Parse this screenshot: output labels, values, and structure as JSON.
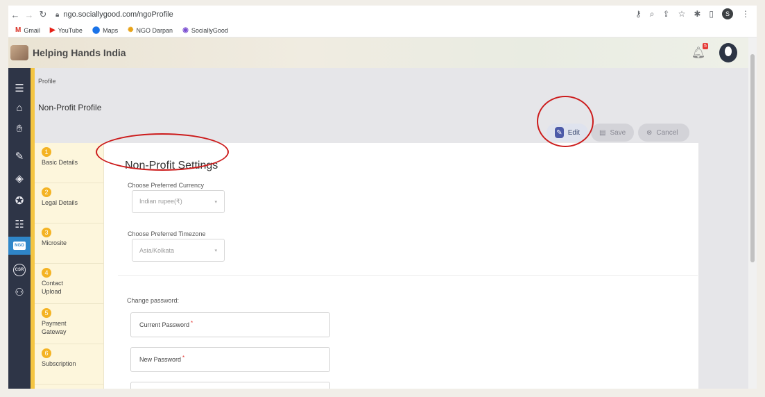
{
  "browser": {
    "url": "ngo.sociallygood.com/ngoProfile",
    "profile_initial": "S",
    "bookmarks": [
      {
        "label": "Gmail",
        "icon": "gmail-icon"
      },
      {
        "label": "YouTube",
        "icon": "youtube-icon"
      },
      {
        "label": "Maps",
        "icon": "maps-icon"
      },
      {
        "label": "NGO Darpan",
        "icon": "ngo-darpan-icon"
      },
      {
        "label": "SociallyGood",
        "icon": "sociallygood-icon"
      }
    ]
  },
  "header": {
    "org_name": "Helping Hands India",
    "notification_count": "5"
  },
  "leftnav": {
    "items": [
      "menu-icon",
      "home-icon",
      "handshake-icon",
      "donation-icon",
      "badge-icon",
      "award-icon",
      "contacts-icon",
      "ngo-icon",
      "csr-icon",
      "users-icon"
    ],
    "active": "ngo-icon",
    "ngo_label": "NGO",
    "csr_label": "CSR"
  },
  "page": {
    "breadcrumb": "Profile",
    "title": "Non-Profit Profile"
  },
  "actions": {
    "edit": "Edit",
    "save": "Save",
    "cancel": "Cancel"
  },
  "steps": [
    {
      "num": "1",
      "label": "Basic Details"
    },
    {
      "num": "2",
      "label": "Legal Details"
    },
    {
      "num": "3",
      "label": "Microsite"
    },
    {
      "num": "4",
      "label": "Contact Upload"
    },
    {
      "num": "5",
      "label": "Payment Gateway"
    },
    {
      "num": "6",
      "label": "Subscription"
    }
  ],
  "settings": {
    "title": "Non-Profit Settings",
    "currency_label": "Choose Preferred Currency",
    "currency_value": "Indian rupee(₹)",
    "timezone_label": "Choose Preferred Timezone",
    "timezone_value": "Asia/Kolkata",
    "change_password_label": "Change password:",
    "current_password": "Current Password",
    "new_password": "New Password",
    "required_mark": "*"
  },
  "colors": {
    "nav_bg": "#2e3547",
    "nav_active": "#2f86c9",
    "step_badge": "#f4b323",
    "annotation": "#cc1b1b"
  }
}
